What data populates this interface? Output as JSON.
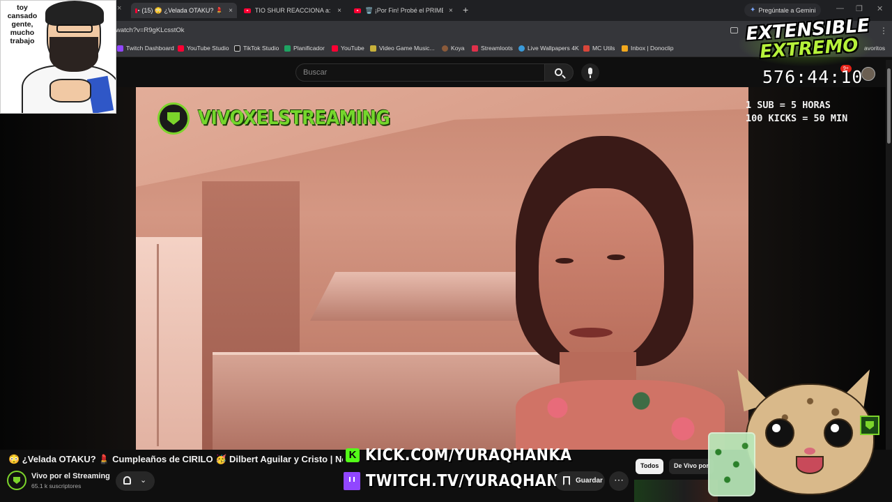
{
  "browser": {
    "tabs": [
      {
        "title": "(15) 😳 ¿Velada OTAKU? 💄",
        "close": "×"
      },
      {
        "title": "TIO SHUR REACCIONA a: \"SIDE",
        "close": "×"
      },
      {
        "title": "🗑️ ¡Por Fin! Probé el PRIMER TE",
        "close": "×"
      }
    ],
    "first_tab_close": "×",
    "new_tab": "+",
    "gemini": "Pregúntale a Gemini",
    "url": "watch?v=R9gKLcsstOk",
    "window_controls": [
      "—",
      "❐",
      "✕"
    ]
  },
  "bookmarks": [
    {
      "label": "Twitch Dashboard",
      "color": "#9146ff"
    },
    {
      "label": "YouTube Studio",
      "color": "#ff0033"
    },
    {
      "label": "TikTok Studio",
      "color": "#222222"
    },
    {
      "label": "Planificador",
      "color": "#1ea362"
    },
    {
      "label": "YouTube",
      "color": "#ff0033"
    },
    {
      "label": "Video Game Music...",
      "color": "#c8b13a"
    },
    {
      "label": "Koya",
      "color": "#8a5a3a"
    },
    {
      "label": "Streamloots",
      "color": "#e0304a"
    },
    {
      "label": "Live Wallpapers 4K",
      "color": "#3a9ad9"
    },
    {
      "label": "MC Utils",
      "color": "#d9463a"
    },
    {
      "label": "Inbox | Donoclip",
      "color": "#f2a81d"
    }
  ],
  "bookmarks_overflow": "avoritos",
  "youtube": {
    "search_placeholder": "Buscar",
    "notification_count": "9+"
  },
  "overlay": {
    "meme_text": "toy cansado gente, mucho trabajo",
    "channel_watermark": "VIVOXELSTREAMING",
    "event_title_line1": "EXTENSIBLE",
    "event_title_line2": "EXTREMO",
    "timer": "576:44:10",
    "rule_1": "1 SUB = 5 HORAS",
    "rule_2": "100 KICKS = 50 MIN",
    "kick_url": "KICK.COM/YURAQHANKA",
    "twitch_url": "TWITCH.TV/YURAQHANKAA"
  },
  "video_info": {
    "title": "😳 ¿Velada OTAKU? 💄 Cumpleaños de CIRILO 🥳 Dilbert Aguilar y Cristo | Noti",
    "channel_name": "Vivo por el Streaming",
    "subscribers": "65.1 k suscriptores",
    "save_label": "Guardar",
    "more_label": "⋯"
  },
  "chips": [
    "Todos",
    "De Vivo por"
  ],
  "colors": {
    "kick_green": "#53fc18",
    "twitch_purple": "#9146ff",
    "channel_green": "#74d62c"
  }
}
